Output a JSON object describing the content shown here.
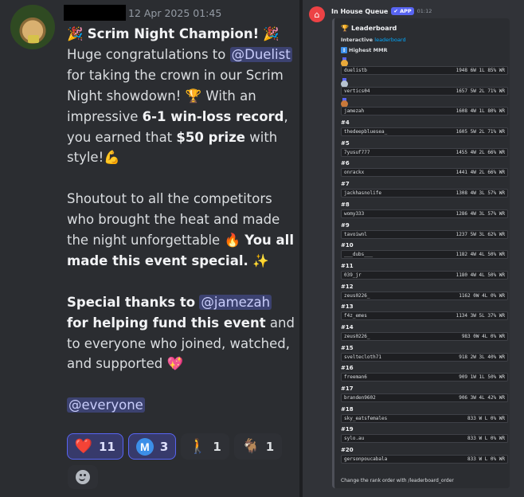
{
  "left": {
    "timestamp": "12 Apr 2025 01:45",
    "message": {
      "title": "Scrim Night Champion!",
      "l1": "Huge congratulations to",
      "mention_duelist": "@Duelist",
      "l2": "for taking the crown in our Scrim Night showdown!",
      "l3": "With an impressive",
      "l3_bold": "6-1 win-loss record",
      "l4": ", you earned that",
      "l4_bold": "$50 prize",
      "l5": "with style!",
      "p2": "Shoutout to all the competitors who brought the heat and made the night unforgettable",
      "p2_bold": "You all made this event special.",
      "p3_bold_a": "Special thanks to",
      "mention_jamezah": "@jamezah",
      "p3_bold_b": "for helping fund this event",
      "p3": "and to everyone who joined, watched, and supported",
      "mention_everyone": "@everyone"
    },
    "reactions": [
      {
        "icon": "heart-emoji",
        "count": "11",
        "active": true
      },
      {
        "icon": "m-logo-emoji",
        "label": "M",
        "count": "3",
        "active": true
      },
      {
        "icon": "person-walking-emoji",
        "count": "1",
        "active": false
      },
      {
        "icon": "goat-emoji",
        "count": "1",
        "active": false
      }
    ]
  },
  "right": {
    "bot_name": "In House Queue",
    "app_badge": "APP",
    "time": "01:12",
    "embed": {
      "title": "Leaderboard",
      "interactive": "Interactive",
      "interactive_link": "leaderboard",
      "sort_label": "Highest MMR",
      "footer": "Change the rank order with /leaderboard_order",
      "ranks": [
        {
          "rank": "🥇",
          "medal": "gold",
          "player": "duelistb",
          "stats": "1948 6W 1L 85% WR"
        },
        {
          "rank": "🥈",
          "medal": "silver",
          "player": "verticsθ4",
          "stats": "1657 5W 2L 71% WR"
        },
        {
          "rank": "🥉",
          "medal": "bronze",
          "player": "jamezah",
          "stats": "1608 4W 1L 80% WR"
        },
        {
          "rank": "#4",
          "player": "thedeepbluesea_",
          "stats": "1605 5W 2L 71% WR"
        },
        {
          "rank": "#5",
          "player": "7yusuf777",
          "stats": "1455 4W 2L 66% WR"
        },
        {
          "rank": "#6",
          "player": "onrackx",
          "stats": "1441 4W 2L 66% WR"
        },
        {
          "rank": "#7",
          "player": "jackhasnolife",
          "stats": "1308 4W 3L 57% WR"
        },
        {
          "rank": "#8",
          "player": "womy333",
          "stats": "1286 4W 3L 57% WR"
        },
        {
          "rank": "#9",
          "player": "tavoiwnl",
          "stats": "1237 5W 3L 62% WR"
        },
        {
          "rank": "#10",
          "player": "___dubs___",
          "stats": "1182 4W 4L 50% WR"
        },
        {
          "rank": "#11",
          "player": "039_jr",
          "stats": "1180 4W 4L 50% WR"
        },
        {
          "rank": "#12",
          "player": "zeus0226_",
          "stats": "1162 0W 4L 0% WR"
        },
        {
          "rank": "#13",
          "player": "f4z_emes",
          "stats": "1134 3W 5L 37% WR"
        },
        {
          "rank": "#14",
          "player": "zeus0226_",
          "stats": "983 0W 4L 0% WR"
        },
        {
          "rank": "#15",
          "player": "sveltecloth71",
          "stats": "918 2W 3L 40% WR"
        },
        {
          "rank": "#16",
          "player": "freeman6",
          "stats": "909 1W 1L 50% WR"
        },
        {
          "rank": "#17",
          "player": "branden9602",
          "stats": "906 3W 4L 42% WR"
        },
        {
          "rank": "#18",
          "player": "sky_eatsfemales",
          "stats": "833 W L 0% WR"
        },
        {
          "rank": "#19",
          "player": "sylo.au",
          "stats": "833 W L 0% WR"
        },
        {
          "rank": "#20",
          "player": "gersonpoucabala",
          "stats": "833 W L 0% WR"
        }
      ]
    }
  }
}
